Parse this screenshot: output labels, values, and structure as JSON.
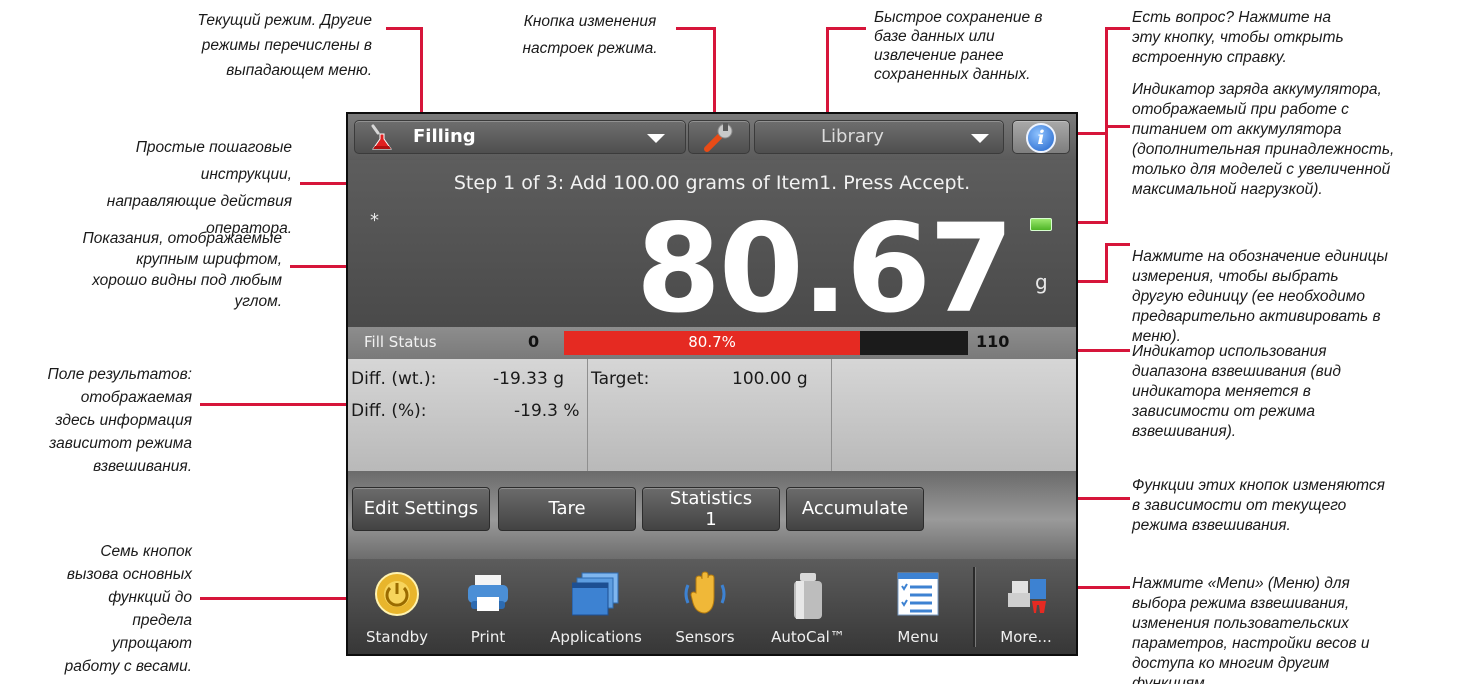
{
  "annotations": {
    "current_mode": "Текущий режим. Другие\nрежимы перечислены в\nвыпадающем меню.",
    "mode_settings": "Кнопка изменения\nнастроек режима.",
    "quick_save": "Быстрое сохранение в\nбазе данных или\nизвлечение ранее\nсохраненных данных.",
    "help": "Есть вопрос? Нажмите на\nэту кнопку, чтобы открыть\nвстроенную справку.",
    "battery": "Индикатор заряда аккумулятора,\nотображаемый при работе с\nпитанием от аккумулятора\n(дополнительная принадлежность,\nтолько для моделей с увеличенной\nмаксимальной нагрузкой).",
    "unit": "Нажмите на обозначение единицы\nизмерения, чтобы выбрать\nдругую единицу (ее необходимо\nпредварительно активировать в\nменю).",
    "steps": "Простые пошаговые\nинструкции,\nнаправляющие действия\nоператора.",
    "reading": "Показания, отображаемые\nкрупным шрифтом,\nхорошо видны под любым\nуглом.",
    "results": "Поле результатов:\nотображаемая\nздесь информация\nзависитот режима\nвзвешивания.",
    "range": "Индикатор использования\nдиапазона взвешивания (вид\nиндикатора меняется в\nзависимости от режима\nвзвешивания).",
    "function_buttons": "Функции этих кнопок изменяются\nв зависимости от текущего\nрежима взвешивания.",
    "seven_buttons": "Семь кнопок\nвызова основных\nфункций до\nпредела\nупрощают\nработу с весами.",
    "menu": "Нажмите «Menu» (Меню) для\nвыбора режима взвешивания,\nизменения пользовательских\nпараметров, настройки весов и\nдоступа ко многим другим\nфункциям."
  },
  "topbar": {
    "mode_label": "Filling",
    "library_label": "Library",
    "info_label": "i"
  },
  "display": {
    "instruction": "Step 1 of 3: Add 100.00 grams of Item1.  Press Accept.",
    "asterisk": "*",
    "reading": "80.67",
    "unit": "g"
  },
  "fill_status": {
    "label": "Fill Status",
    "min": "0",
    "max": "110",
    "percent_label": "80.7%",
    "fraction": 0.733
  },
  "results": {
    "diff_wt_label": "Diff. (wt.):",
    "diff_wt_value": "-19.33 g",
    "diff_pct_label": "Diff. (%):",
    "diff_pct_value": "-19.3 %",
    "target_label": "Target:",
    "target_value": "100.00 g"
  },
  "function_buttons": {
    "edit_settings": "Edit Settings",
    "tare": "Tare",
    "statistics": "Statistics",
    "statistics_count": "1",
    "accumulate": "Accumulate"
  },
  "dock": {
    "standby": "Standby",
    "print": "Print",
    "applications": "Applications",
    "sensors": "Sensors",
    "autocal": "AutoCal™",
    "menu": "Menu",
    "more": "More..."
  },
  "colors": {
    "annotation_line": "#d6153a",
    "fill_bar": "#e52a22",
    "battery": "#5cc734"
  }
}
